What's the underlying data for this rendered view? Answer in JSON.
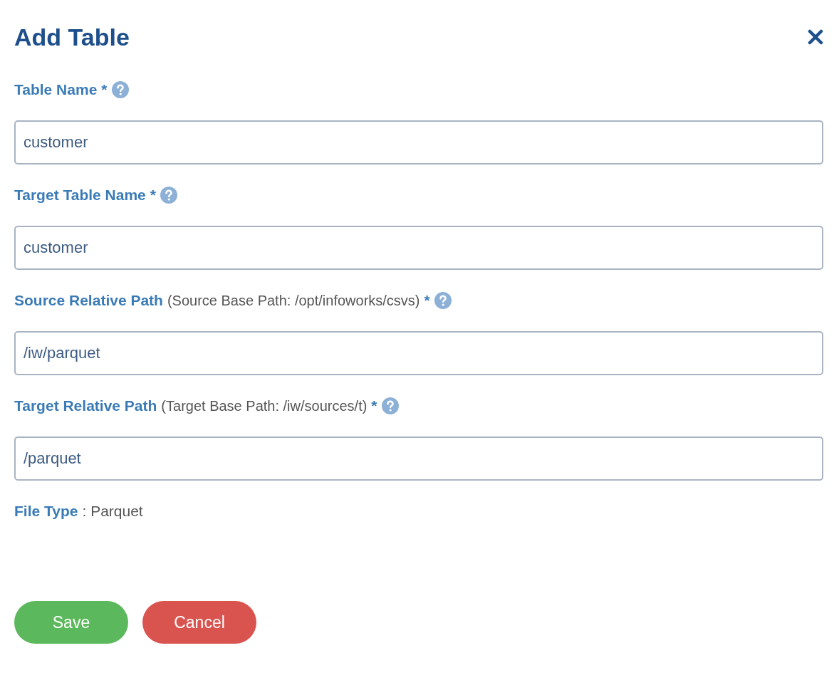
{
  "dialog": {
    "title": "Add Table"
  },
  "fields": [
    {
      "label": "Table Name",
      "required_mark": "*",
      "value": "customer"
    },
    {
      "label": "Target Table Name",
      "required_mark": "*",
      "value": "customer"
    },
    {
      "label": "Source Relative Path",
      "note": "(Source Base Path: /opt/infoworks/csvs)",
      "required_mark": "*",
      "value": "/iw/parquet"
    },
    {
      "label": "Target Relative Path",
      "note": "(Target Base Path: /iw/sources/t)",
      "required_mark": "*",
      "value": "/parquet"
    }
  ],
  "file_type": {
    "label": "File Type",
    "value": ": Parquet"
  },
  "buttons": [
    {
      "label": "Save",
      "kind": "primary"
    },
    {
      "label": "Cancel",
      "kind": "danger"
    }
  ]
}
